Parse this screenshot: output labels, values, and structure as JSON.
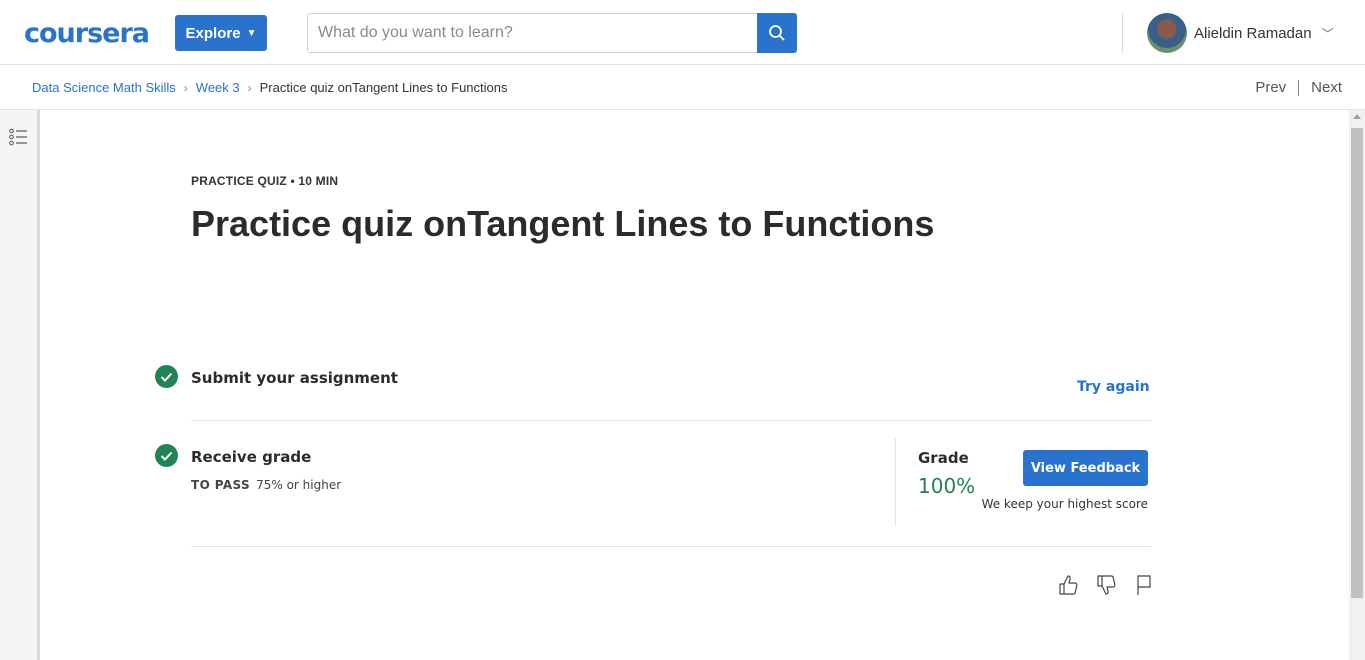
{
  "header": {
    "logo_text": "coursera",
    "explore_label": "Explore",
    "search": {
      "placeholder": "What do you want to learn?",
      "value": ""
    },
    "user_name": "Alieldin Ramadan"
  },
  "breadcrumb": {
    "items": [
      "Data Science Math Skills",
      "Week 3"
    ],
    "current": "Practice quiz onTangent Lines to Functions",
    "prev_label": "Prev",
    "next_label": "Next"
  },
  "quiz": {
    "meta": "PRACTICE QUIZ • 10 MIN",
    "title": "Practice quiz onTangent Lines to Functions"
  },
  "steps": {
    "submit": {
      "title": "Submit your assignment",
      "action_label": "Try again"
    },
    "grade": {
      "title": "Receive grade",
      "to_pass_label": "TO PASS",
      "to_pass_value": "75% or higher",
      "grade_label": "Grade",
      "grade_value": "100%",
      "view_feedback_label": "View Feedback",
      "highest_note": "We keep your highest score"
    }
  },
  "colors": {
    "accent": "#2a73cc",
    "success": "#1f8354"
  },
  "icons": [
    "search-icon",
    "chevron-down-icon",
    "list-icon",
    "check-icon",
    "thumbs-up-icon",
    "thumbs-down-icon",
    "flag-icon"
  ]
}
